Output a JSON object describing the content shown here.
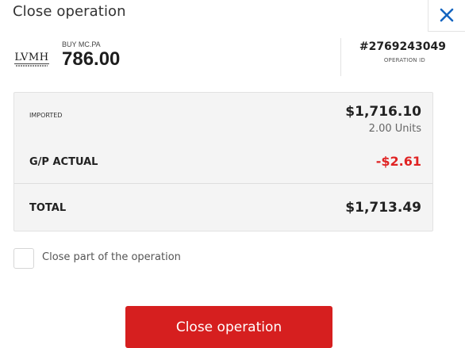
{
  "dialog": {
    "title": "Close operation"
  },
  "operation": {
    "logo_text": "LVMH",
    "label": "BUY MC.PA",
    "price": "786.00",
    "id": "#2769243049",
    "id_label": "OPERATION ID"
  },
  "summary": {
    "imported_label": "IMPORTED",
    "imported_value": "$1,716.10",
    "units": "2.00 Units",
    "gp_label": "G/P ACTUAL",
    "gp_value": "-$2.61",
    "total_label": "TOTAL",
    "total_value": "$1,713.49"
  },
  "partial_close": {
    "label": "Close part of the operation",
    "checked": false
  },
  "actions": {
    "close_operation": "Close operation"
  },
  "icons": {
    "close": "close-icon",
    "logo": "lvmh-logo"
  },
  "colors": {
    "accent": "#d61f1f",
    "negative": "#e02424",
    "close_icon": "#1565c0"
  }
}
